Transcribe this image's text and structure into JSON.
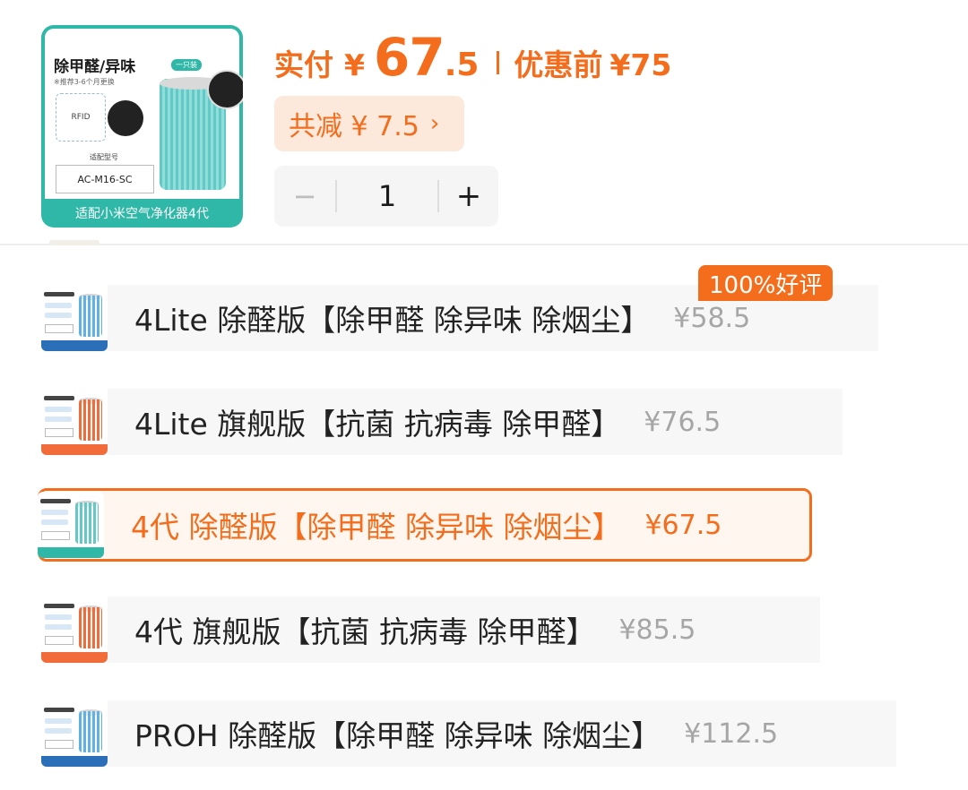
{
  "product": {
    "thumbnail": {
      "title": "除甲醛/异味",
      "badge": "一只装",
      "subtitle": "※推荐3-6个月更换",
      "rfid_label": "RFID",
      "model_label": "适配型号",
      "model": "AC-M16-SC",
      "caption": "适配小米空气净化器4代",
      "accent_color": "#2fb7a7"
    },
    "price": {
      "paid_label": "实付",
      "currency": "¥",
      "paid_int": "67",
      "paid_dec": ".5",
      "original_label": "优惠前",
      "original": "¥75",
      "accent_color": "#f46d1c"
    },
    "discount": {
      "label": "共减 ¥ 7.5",
      "chevron": "›"
    },
    "quantity": {
      "minus": "−",
      "value": "1",
      "plus": "+"
    }
  },
  "rating_badge": "100%好评",
  "variants": [
    {
      "label": "4Lite 除醛版【除甲醛 除异味 除烟尘】",
      "price": "¥58.5",
      "filter_color": "#5fb1e6",
      "bar_color": "#2b6fb8",
      "selected": false
    },
    {
      "label": "4Lite 旗舰版【抗菌 抗病毒 除甲醛】",
      "price": "¥76.5",
      "filter_color": "#f26b3a",
      "bar_color": "#f26b3a",
      "selected": false
    },
    {
      "label": "4代 除醛版【除甲醛 除异味 除烟尘】",
      "price": "¥67.5",
      "filter_color": "#62c9c6",
      "bar_color": "#2fb7a7",
      "selected": true
    },
    {
      "label": "4代 旗舰版【抗菌 抗病毒 除甲醛】",
      "price": "¥85.5",
      "filter_color": "#f26b3a",
      "bar_color": "#f26b3a",
      "selected": false
    },
    {
      "label": "PROH 除醛版【除甲醛 除异味 除烟尘】",
      "price": "¥112.5",
      "filter_color": "#5fb1e6",
      "bar_color": "#2b6fb8",
      "selected": false
    }
  ]
}
